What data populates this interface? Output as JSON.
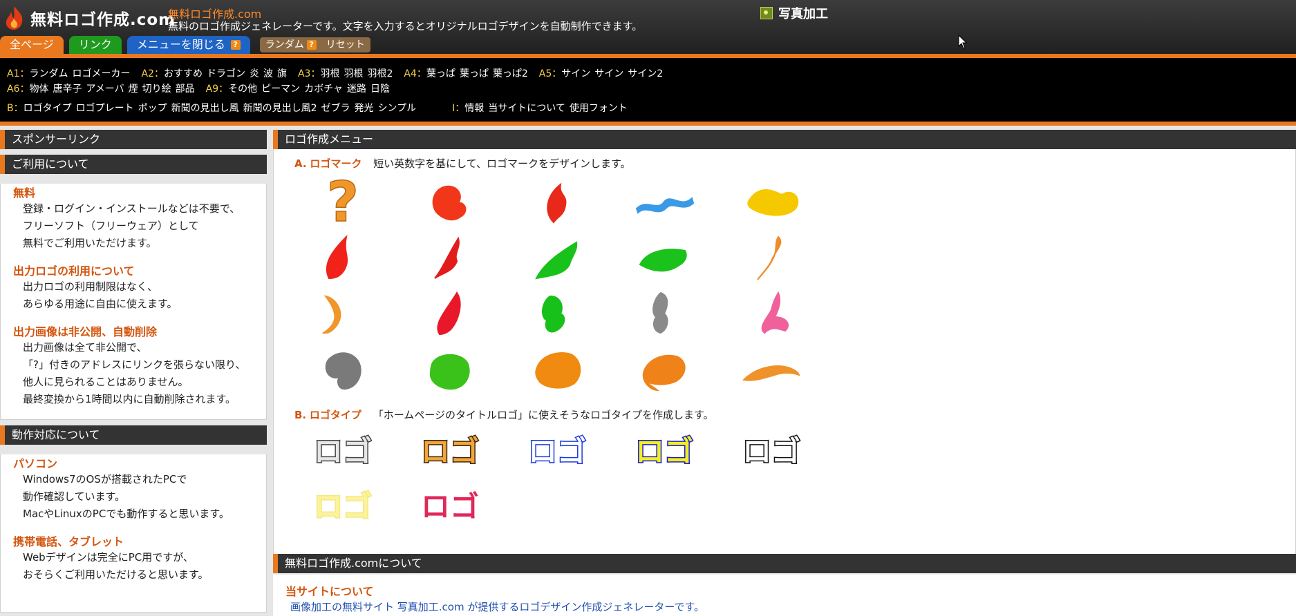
{
  "header": {
    "logo_text": "無料ロゴ作成.com",
    "site_name": "無料ロゴ作成.com",
    "site_desc": "無料のロゴ作成ジェネレーターです。文字を入力するとオリジナルロゴデザインを自動制作できます。",
    "photo_link": "写真加工"
  },
  "tabs": {
    "all": "全ページ",
    "links": "リンク",
    "menu": "メニューを閉じる",
    "random": "ランダム",
    "reset": "リセット",
    "q": "?"
  },
  "catnav": {
    "row1": [
      {
        "label": "A1：",
        "links": [
          "ランダム",
          "ロゴメーカー"
        ]
      },
      {
        "label": "A2：",
        "links": [
          "おすすめ",
          "ドラゴン",
          "炎",
          "波",
          "旗"
        ]
      },
      {
        "label": "A3：",
        "links": [
          "羽根",
          "羽根",
          "羽根2"
        ]
      },
      {
        "label": "A4：",
        "links": [
          "葉っぱ",
          "葉っぱ",
          "葉っぱ2"
        ]
      },
      {
        "label": "A5：",
        "links": [
          "サイン",
          "サイン",
          "サイン2"
        ]
      }
    ],
    "row2": [
      {
        "label": "A6：",
        "links": [
          "物体",
          "唐辛子",
          "アメーバ",
          "煙",
          "切り絵",
          "部品"
        ]
      },
      {
        "label": "A9：",
        "links": [
          "その他",
          "ピーマン",
          "カボチャ",
          "迷路",
          "日陰"
        ]
      }
    ],
    "row3": [
      {
        "label": "B：",
        "links": [
          "ロゴタイプ",
          "ロゴプレート",
          "ポップ",
          "新聞の見出し風",
          "新聞の見出し風2",
          "ゼブラ",
          "発光",
          "シンプル"
        ]
      },
      {
        "label": "I：",
        "links": [
          "情報",
          "当サイトについて",
          "使用フォント"
        ]
      }
    ]
  },
  "sidebar": {
    "sponsor": "スポンサーリンク",
    "usage_head": "ご利用について",
    "free_title": "無料",
    "free_lines": [
      "登録・ログイン・インストールなどは不要で、",
      "フリーソフト（フリーウェア）として",
      "無料でご利用いただけます。"
    ],
    "output_title": "出力ロゴの利用について",
    "output_lines": [
      "出力ロゴの利用制限はなく、",
      "あらゆる用途に自由に使えます。"
    ],
    "private_title": "出力画像は非公開、自動削除",
    "private_lines": [
      "出力画像は全て非公開で、",
      "「?」付きのアドレスにリンクを張らない限り、",
      "他人に見られることはありません。",
      "最終変換から1時間以内に自動削除されます。"
    ],
    "compat_head": "動作対応について",
    "pc_title": "パソコン",
    "pc_lines": [
      "Windows7のOSが搭載されたPCで",
      "動作確認しています。",
      "MacやLinuxのPCでも動作すると思います。"
    ],
    "mobile_title": "携帯電話、タブレット",
    "mobile_lines": [
      "Webデザインは完全にPC用ですが、",
      "おそらくご利用いただけると思います。"
    ]
  },
  "main": {
    "menu_head": "ロゴ作成メニュー",
    "secA_code": "A.",
    "secA_name": "ロゴマーク",
    "secA_desc": "短い英数字を基にして、ロゴマークをデザインします。",
    "secB_code": "B.",
    "secB_name": "ロゴタイプ",
    "secB_desc": "「ホームページのタイトルロゴ」に使えそうなロゴタイプを作成します。",
    "logotype_text": "ロゴ",
    "about_head": "無料ロゴ作成.comについて",
    "about_title": "当サイトについて",
    "about_partial": "画像加工の無料サイト 写真加工.com が提供するロゴデザイン作成ジェネレーターです。"
  },
  "colors": {
    "accent": "#e9781e",
    "heading_text": "#d4550e",
    "tab_green": "#1f9a1f",
    "tab_blue": "#1f63c5"
  },
  "logomarks": [
    {
      "icon": "question-mark",
      "color": "#f0962a"
    },
    {
      "icon": "dragon-swirl",
      "color": "#f2361a"
    },
    {
      "icon": "flame-swirl",
      "color": "#e8291a"
    },
    {
      "icon": "wave-script",
      "color": "#3a9ae6"
    },
    {
      "icon": "flag-blob",
      "color": "#f6c800"
    },
    {
      "icon": "feather-red",
      "color": "#f0221a"
    },
    {
      "icon": "feather-red-2",
      "color": "#e21c1c"
    },
    {
      "icon": "leaf-green",
      "color": "#18c21a"
    },
    {
      "icon": "leaf-green-2",
      "color": "#1cc21c"
    },
    {
      "icon": "sign-orange",
      "color": "#f08a2a"
    },
    {
      "icon": "sign-orange-2",
      "color": "#f0962a"
    },
    {
      "icon": "chili-red",
      "color": "#e8182a"
    },
    {
      "icon": "amoeba-green",
      "color": "#18c01a"
    },
    {
      "icon": "smoke-gray",
      "color": "#8a8a8a"
    },
    {
      "icon": "cutout-pink",
      "color": "#f0609a"
    },
    {
      "icon": "part-gray",
      "color": "#7a7a7a"
    },
    {
      "icon": "pepper-green",
      "color": "#3ac21a"
    },
    {
      "icon": "pumpkin-orange",
      "color": "#f08a10"
    },
    {
      "icon": "maze-orange",
      "color": "#f0821a"
    },
    {
      "icon": "shade-orange",
      "color": "#f0922a"
    }
  ],
  "logotypes": [
    {
      "style": "plate-gray",
      "fill": "#e6e6e6",
      "stroke": "#444444"
    },
    {
      "style": "pop-orange",
      "fill": "#f3a53a",
      "stroke": "#3a2a10"
    },
    {
      "style": "newspaper-blue",
      "fill": "#ffffff",
      "stroke": "#1a3adb"
    },
    {
      "style": "newspaper2-yellow",
      "fill": "#f2f01a",
      "stroke": "#1a1ad8"
    },
    {
      "style": "zebra-white",
      "fill": "#ffffff",
      "stroke": "#111111"
    },
    {
      "style": "glow-yellow",
      "fill": "#fbf3a0",
      "stroke": "#f4e97a"
    },
    {
      "style": "simple-pink",
      "fill": "#e0285a",
      "stroke": "#e0285a"
    }
  ]
}
